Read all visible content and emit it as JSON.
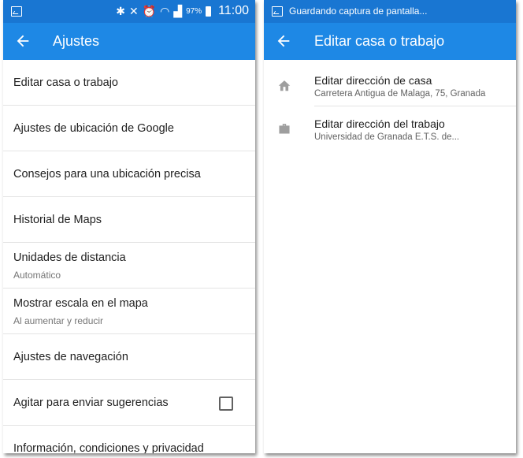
{
  "left": {
    "status": {
      "battery": "97%",
      "time": "11:00"
    },
    "toolbar": {
      "title": "Ajustes"
    },
    "settings": [
      {
        "label": "Editar casa o trabajo"
      },
      {
        "label": "Ajustes de ubicación de Google"
      },
      {
        "label": "Consejos para una ubicación precisa"
      },
      {
        "label": "Historial de Maps"
      },
      {
        "label": "Unidades de distancia",
        "sub": "Automático"
      },
      {
        "label": "Mostrar escala en el mapa",
        "sub": "Al aumentar y reducir"
      },
      {
        "label": "Ajustes de navegación"
      },
      {
        "label": "Agitar para enviar sugerencias",
        "checked": false
      },
      {
        "label": "Información, condiciones y privacidad"
      }
    ]
  },
  "right": {
    "status": {
      "notification": "Guardando captura de pantalla..."
    },
    "toolbar": {
      "title": "Editar casa o trabajo"
    },
    "items": [
      {
        "icon": "home-icon",
        "title": "Editar dirección de casa",
        "detail": "Carretera Antigua de Malaga, 75, Granada"
      },
      {
        "icon": "briefcase-icon",
        "title": "Editar dirección del trabajo",
        "detail": "Universidad de Granada E.T.S. de..."
      }
    ]
  },
  "colors": {
    "toolbar": "#1e88e5",
    "statusbar": "#1976d2",
    "icon_grey": "#9e9e9e"
  }
}
